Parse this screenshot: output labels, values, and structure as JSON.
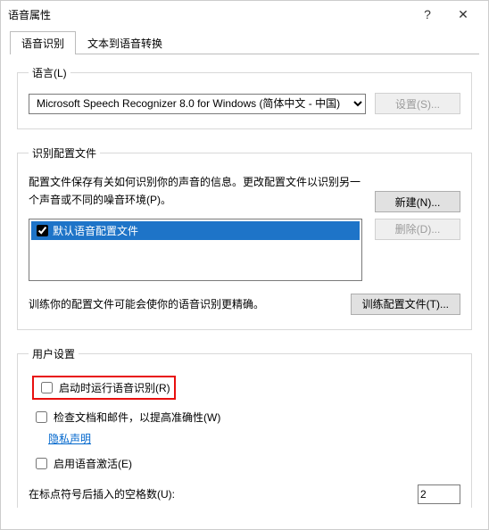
{
  "titlebar": {
    "title": "语音属性",
    "help": "?",
    "close": "✕"
  },
  "tabs": {
    "active": "语音识别",
    "inactive": "文本到语音转换"
  },
  "language_group": {
    "legend": "语言(L)",
    "selected": "Microsoft Speech Recognizer 8.0 for Windows (简体中文 - 中国)",
    "settings_btn": "设置(S)..."
  },
  "profile_group": {
    "legend": "识别配置文件",
    "desc": "配置文件保存有关如何识别你的声音的信息。更改配置文件以识别另一个声音或不同的噪音环境(P)。",
    "new_btn": "新建(N)...",
    "delete_btn": "删除(D)...",
    "default_profile": "默认语音配置文件",
    "train_desc": "训练你的配置文件可能会使你的语音识别更精确。",
    "train_btn": "训练配置文件(T)..."
  },
  "user_group": {
    "legend": "用户设置",
    "run_at_startup": "启动时运行语音识别(R)",
    "review_docs": "检查文档和邮件，以提高准确性(W)",
    "privacy_link": "隐私声明",
    "enable_voice_activate": "启用语音激活(E)",
    "spaces_label": "在标点符号后插入的空格数(U):",
    "spaces_value": "2"
  }
}
